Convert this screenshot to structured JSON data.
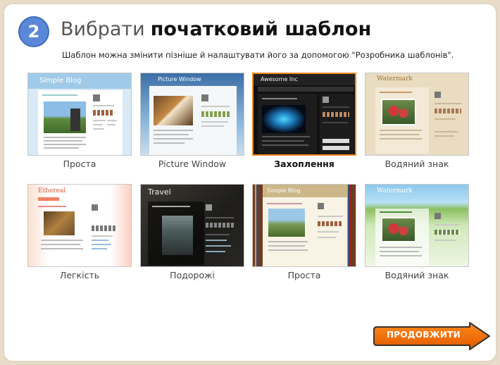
{
  "step": {
    "number": "2",
    "title_light": "Вибрати",
    "title_bold": "початковий шаблон",
    "subtitle": "Шаблон можна змінити пізніше й налаштувати його за допомогою \"Розробника шаблонів\"."
  },
  "templates": [
    {
      "label": "Проста",
      "thumb_title": "Simple Blog",
      "selected": false
    },
    {
      "label": "Picture Window",
      "thumb_title": "Picture Window",
      "selected": false
    },
    {
      "label": "Захоплення",
      "thumb_title": "Awesome Inc",
      "selected": true
    },
    {
      "label": "Водяний знак",
      "thumb_title": "Watermark",
      "selected": false
    },
    {
      "label": "Легкість",
      "thumb_title": "Ethereal",
      "selected": false
    },
    {
      "label": "Подорожі",
      "thumb_title": "Travel",
      "selected": false
    },
    {
      "label": "Проста",
      "thumb_title": "Simple Blog",
      "selected": false
    },
    {
      "label": "Водяний знак",
      "thumb_title": "Watermark",
      "selected": false
    }
  ],
  "next_button": {
    "label": "ПРОДОВЖИТИ"
  },
  "colors": {
    "accent_orange": "#f08a1c",
    "step_blue": "#5b87d9",
    "page_bg": "#e8dcc8"
  },
  "icons": {
    "next": "arrow-right-icon"
  }
}
